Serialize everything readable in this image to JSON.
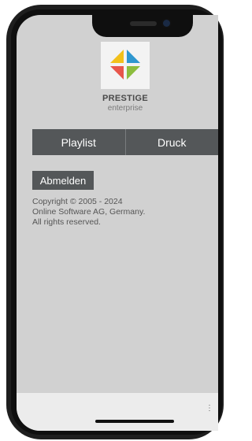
{
  "app": {
    "logo_name": "PRESTIGE",
    "logo_sub": "enterprise"
  },
  "nav": {
    "items": [
      {
        "label": "Playlist"
      },
      {
        "label": "Druck"
      }
    ]
  },
  "logout_label": "Abmelden",
  "copyright": {
    "line1": "Copyright © 2005 - 2024",
    "line2": "Online Software AG, Germany.",
    "line3": "All rights reserved."
  },
  "bottom_bar": {
    "more_icon": "⋮"
  },
  "colors": {
    "background": "#d1d1d1",
    "button": "#545759",
    "logo_yellow": "#f2c01a",
    "logo_blue": "#2f97cf",
    "logo_red": "#e8564b",
    "logo_green": "#8cbd3e"
  }
}
